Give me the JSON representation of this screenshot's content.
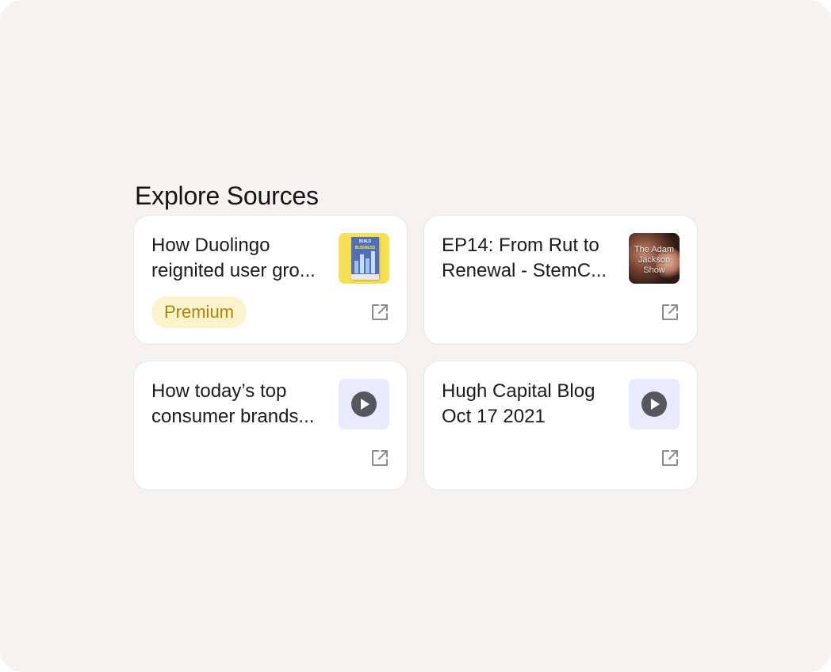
{
  "section": {
    "title": "Explore Sources"
  },
  "cards": [
    {
      "title_line1": "How Duolingo",
      "title_line2": "reignited user gro...",
      "thumbnail": "book-cover-thumbnail",
      "thumbnail_text_1": "BUILD",
      "thumbnail_text_2": "BUSINESS",
      "badge": "Premium",
      "link_icon": "external-link-icon"
    },
    {
      "title_line1": "EP14: From Rut to",
      "title_line2": "Renewal - StemC...",
      "thumbnail": "podcast-cover-thumbnail",
      "thumbnail_text": "The Adam Jackson Show",
      "link_icon": "external-link-icon"
    },
    {
      "title_line1": "How today’s top",
      "title_line2": "consumer brands...",
      "thumbnail": "play-icon",
      "link_icon": "external-link-icon"
    },
    {
      "title_line1": "Hugh Capital Blog",
      "title_line2": "Oct 17 2021",
      "thumbnail": "play-icon",
      "link_icon": "external-link-icon"
    }
  ],
  "colors": {
    "background": "#f5f2ef",
    "card": "#ffffff",
    "badge_bg": "#fcf2cc",
    "badge_text": "#a9860a",
    "video_thumb_bg": "#e8ebfd"
  }
}
